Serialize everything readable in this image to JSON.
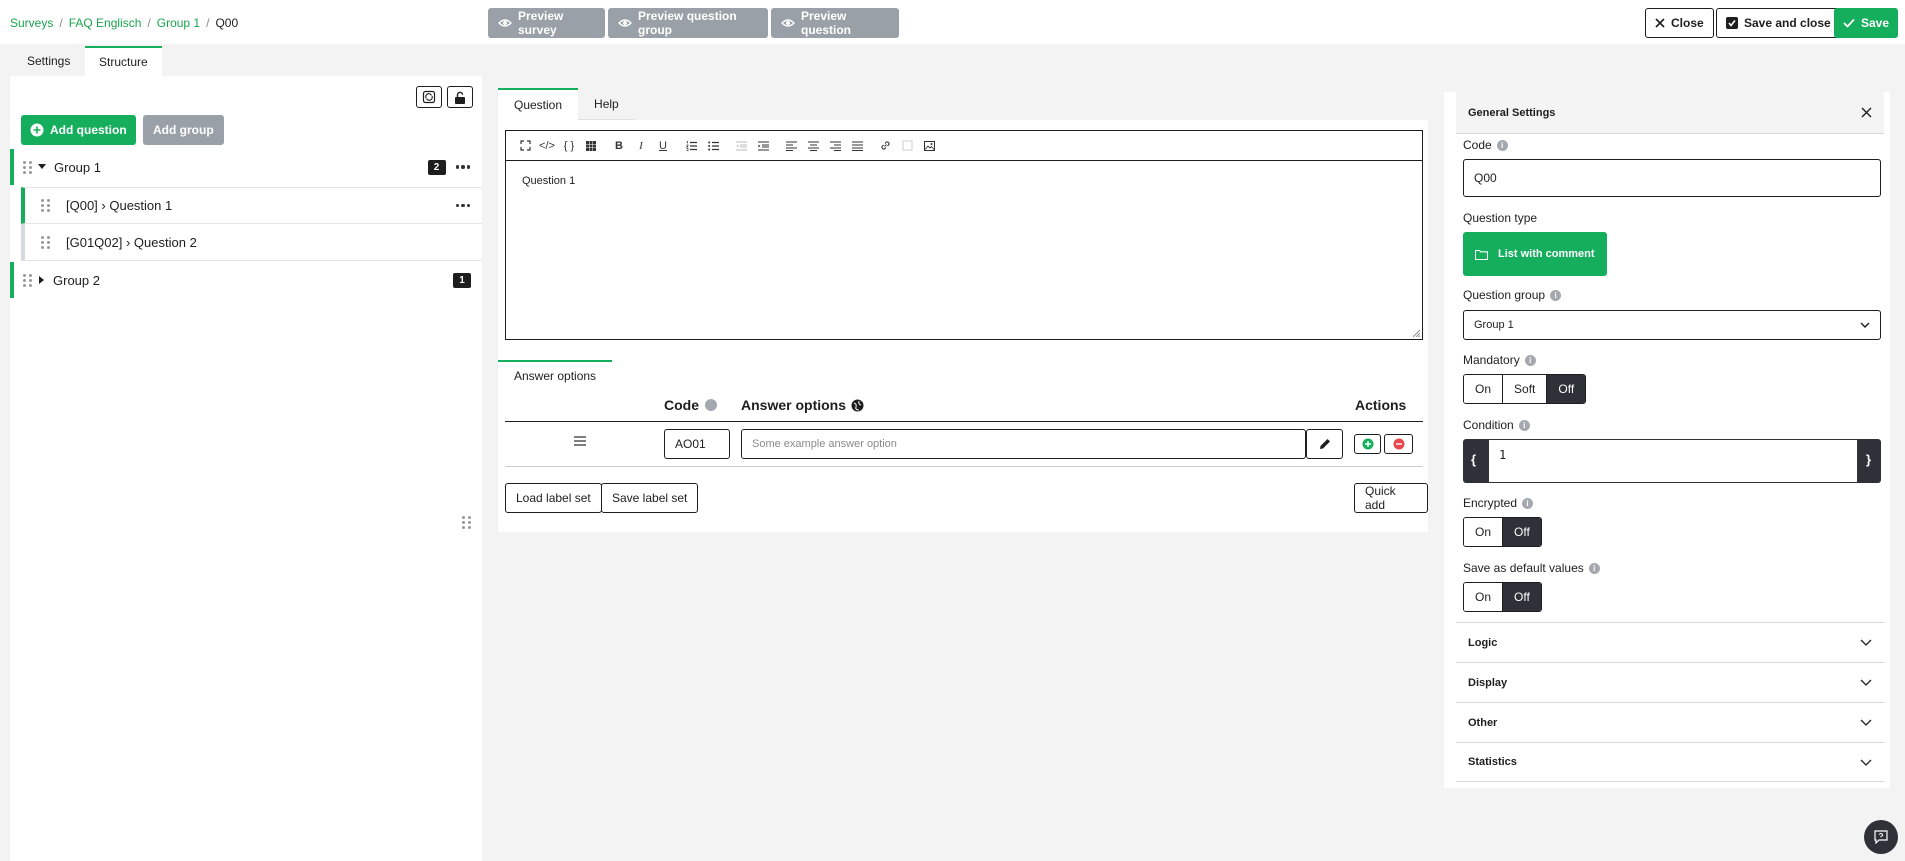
{
  "breadcrumb": [
    "Surveys",
    "FAQ Englisch",
    "Group 1",
    "Q00"
  ],
  "preview": {
    "survey": "Preview survey",
    "group": "Preview question group",
    "question": "Preview question"
  },
  "actions": {
    "close": "Close",
    "save_close": "Save and close",
    "save": "Save"
  },
  "top_tabs": {
    "settings": "Settings",
    "structure": "Structure"
  },
  "left": {
    "add_question": "Add question",
    "add_group": "Add group",
    "groups": [
      {
        "name": "Group 1",
        "count": "2",
        "questions": [
          "[Q00] › Question 1",
          "[G01Q02] › Question 2"
        ]
      },
      {
        "name": "Group 2",
        "count": "1"
      }
    ]
  },
  "editor": {
    "tabs": {
      "question": "Question",
      "help": "Help"
    },
    "content": "Question 1"
  },
  "answers": {
    "tab": "Answer options",
    "col_code": "Code",
    "col_options": "Answer options",
    "col_actions": "Actions",
    "row_code": "AO01",
    "row_placeholder": "Some example answer option",
    "load_label": "Load label set",
    "save_label": "Save label set",
    "quick_add": "Quick add"
  },
  "settings": {
    "title": "General Settings",
    "code_label": "Code",
    "code_value": "Q00",
    "qtype_label": "Question type",
    "qtype_value": "List with comment",
    "qgroup_label": "Question group",
    "qgroup_value": "Group 1",
    "mandatory_label": "Mandatory",
    "mandatory": {
      "on": "On",
      "soft": "Soft",
      "off": "Off"
    },
    "condition_label": "Condition",
    "condition_open": "{",
    "condition_value": "1",
    "condition_close": "}",
    "encrypted_label": "Encrypted",
    "default_label": "Save as default values",
    "on": "On",
    "off": "Off",
    "sections": [
      "Logic",
      "Display",
      "Other",
      "Statistics"
    ]
  },
  "colors": {
    "accent": "#14ae5c",
    "dark": "#2e3138",
    "muted_button": "#9aa0a7"
  }
}
